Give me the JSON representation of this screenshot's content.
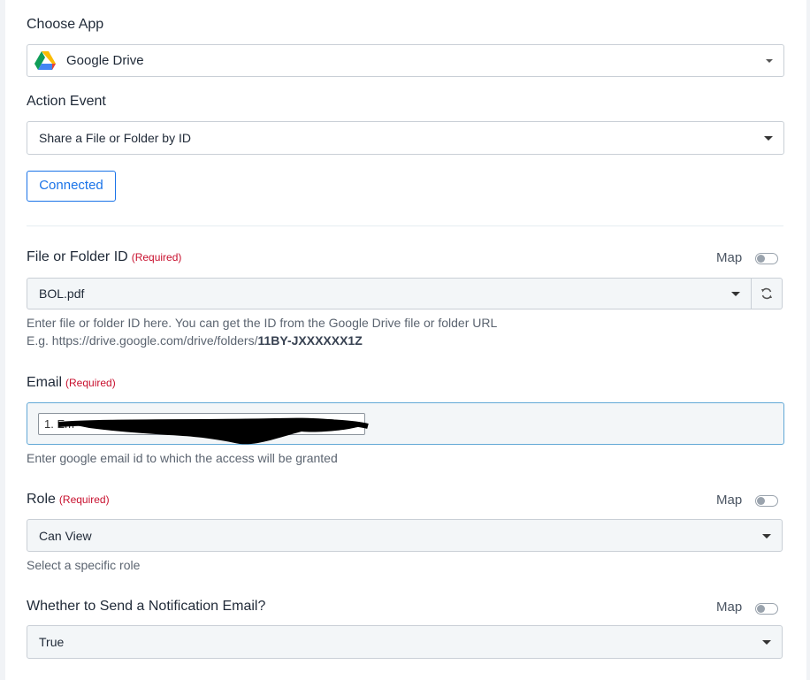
{
  "choose_app": {
    "label": "Choose App",
    "value": "Google Drive",
    "icon": "google-drive-icon"
  },
  "action_event": {
    "label": "Action Event",
    "value": "Share a File or Folder by ID"
  },
  "connected_button": "Connected",
  "required_text": "(Required)",
  "map_label": "Map",
  "file_field": {
    "label": "File or Folder ID",
    "value": "BOL.pdf",
    "help_line1": "Enter file or folder ID here. You can get the ID from the Google Drive file or folder URL",
    "help_prefix": "E.g. https://drive.google.com/drive/folders/",
    "help_bold": "11BY-JXXXXXX1Z"
  },
  "email_field": {
    "label": "Email",
    "chip": "1. Em",
    "help": "Enter google email id to which the access will be granted"
  },
  "role_field": {
    "label": "Role",
    "value": "Can View",
    "help": "Select a specific role"
  },
  "notification_field": {
    "label": "Whether to Send a Notification Email?",
    "value": "True"
  },
  "colors": {
    "accent": "#1a73e8",
    "required": "#c8102e",
    "redaction": "#000000"
  }
}
